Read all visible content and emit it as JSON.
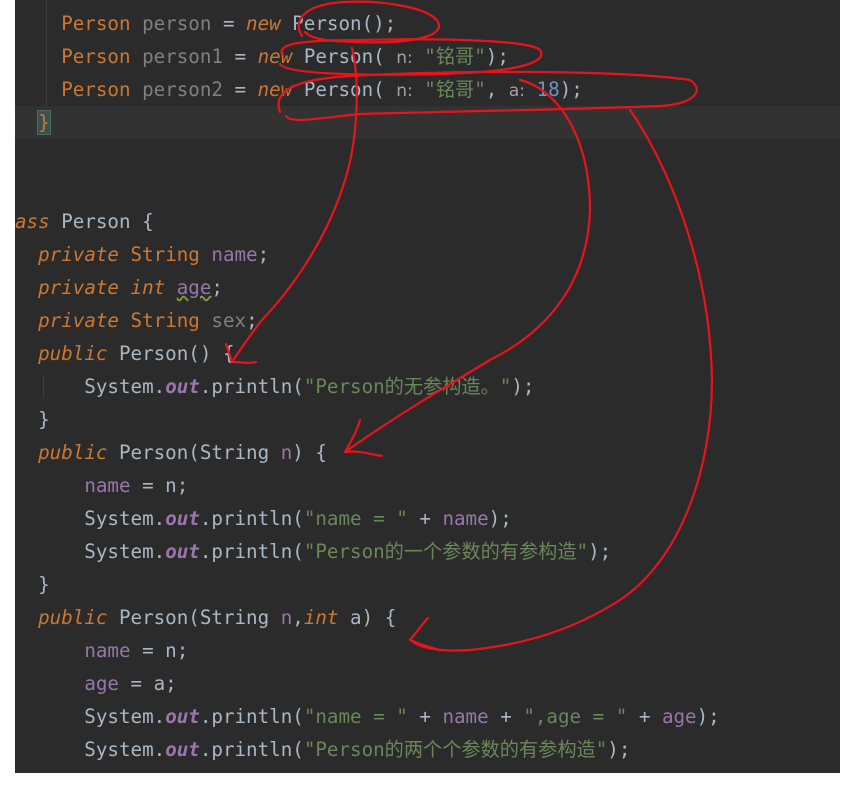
{
  "lines": [
    [
      {
        "t": "    Person ",
        "c": "k"
      },
      {
        "t": "person",
        "c": "gr"
      },
      {
        "t": " = ",
        "c": "t"
      },
      {
        "t": "new",
        "c": "ki"
      },
      {
        "t": " Person();",
        "c": "t"
      }
    ],
    [
      {
        "t": "    Person ",
        "c": "k"
      },
      {
        "t": "person1",
        "c": "gr"
      },
      {
        "t": " = ",
        "c": "t"
      },
      {
        "t": "new",
        "c": "ki"
      },
      {
        "t": " Person( ",
        "c": "t"
      },
      {
        "t": "n:",
        "c": "ph"
      },
      {
        "t": " \"铭哥\"",
        "c": "s"
      },
      {
        "t": ");",
        "c": "t"
      }
    ],
    [
      {
        "t": "    Person ",
        "c": "k"
      },
      {
        "t": "person2",
        "c": "gr"
      },
      {
        "t": " = ",
        "c": "t"
      },
      {
        "t": "new",
        "c": "ki"
      },
      {
        "t": " Person( ",
        "c": "t"
      },
      {
        "t": "n:",
        "c": "ph"
      },
      {
        "t": " \"铭哥\"",
        "c": "s"
      },
      {
        "t": ", ",
        "c": "t"
      },
      {
        "t": "a:",
        "c": "ph"
      },
      {
        "t": " 18",
        "c": "num"
      },
      {
        "t": ");",
        "c": "t"
      }
    ],
    [
      {
        "t": "  ",
        "c": "t"
      },
      {
        "t": "}",
        "c": "brace"
      }
    ],
    [],
    [],
    [
      {
        "t": "ass ",
        "c": "ki"
      },
      {
        "t": "Person {",
        "c": "t"
      }
    ],
    [
      {
        "t": "  ",
        "c": "t"
      },
      {
        "t": "private",
        "c": "ki"
      },
      {
        "t": " String ",
        "c": "k"
      },
      {
        "t": "name",
        "c": "f"
      },
      {
        "t": ";",
        "c": "t"
      }
    ],
    [
      {
        "t": "  ",
        "c": "t"
      },
      {
        "t": "private",
        "c": "ki"
      },
      {
        "t": " int ",
        "c": "ki"
      },
      {
        "t": "age",
        "c": "fw"
      },
      {
        "t": ";",
        "c": "t"
      }
    ],
    [
      {
        "t": "  ",
        "c": "t"
      },
      {
        "t": "private",
        "c": "ki"
      },
      {
        "t": " String ",
        "c": "k"
      },
      {
        "t": "sex",
        "c": "gr"
      },
      {
        "t": ";",
        "c": "t"
      }
    ],
    [
      {
        "t": "  ",
        "c": "t"
      },
      {
        "t": "public",
        "c": "ki"
      },
      {
        "t": " Person() {",
        "c": "t"
      }
    ],
    [
      {
        "t": "      System.",
        "c": "t"
      },
      {
        "t": "out",
        "c": "fb"
      },
      {
        "t": ".println(",
        "c": "t"
      },
      {
        "t": "\"Person的无参构造。\"",
        "c": "s"
      },
      {
        "t": ");",
        "c": "t"
      }
    ],
    [
      {
        "t": "  }",
        "c": "t"
      }
    ],
    [
      {
        "t": "  ",
        "c": "t"
      },
      {
        "t": "public",
        "c": "ki"
      },
      {
        "t": " Person(String ",
        "c": "t"
      },
      {
        "t": "n",
        "c": "f"
      },
      {
        "t": ") {",
        "c": "t"
      }
    ],
    [
      {
        "t": "      ",
        "c": "t"
      },
      {
        "t": "name",
        "c": "f"
      },
      {
        "t": " = n;",
        "c": "t"
      }
    ],
    [
      {
        "t": "      System.",
        "c": "t"
      },
      {
        "t": "out",
        "c": "fb"
      },
      {
        "t": ".println(",
        "c": "t"
      },
      {
        "t": "\"name = \"",
        "c": "s"
      },
      {
        "t": " + ",
        "c": "t"
      },
      {
        "t": "name",
        "c": "f"
      },
      {
        "t": ");",
        "c": "t"
      }
    ],
    [
      {
        "t": "      System.",
        "c": "t"
      },
      {
        "t": "out",
        "c": "fb"
      },
      {
        "t": ".println(",
        "c": "t"
      },
      {
        "t": "\"Person的一个参数的有参构造\"",
        "c": "s"
      },
      {
        "t": ");",
        "c": "t"
      }
    ],
    [
      {
        "t": "  }",
        "c": "t"
      }
    ],
    [
      {
        "t": "  ",
        "c": "t"
      },
      {
        "t": "public",
        "c": "ki"
      },
      {
        "t": " Person(String ",
        "c": "t"
      },
      {
        "t": "n",
        "c": "f"
      },
      {
        "t": ",",
        "c": "t"
      },
      {
        "t": "int",
        "c": "ki"
      },
      {
        "t": " a) {",
        "c": "t"
      }
    ],
    [
      {
        "t": "      ",
        "c": "t"
      },
      {
        "t": "name",
        "c": "f"
      },
      {
        "t": " = n;",
        "c": "t"
      }
    ],
    [
      {
        "t": "      ",
        "c": "t"
      },
      {
        "t": "age",
        "c": "f"
      },
      {
        "t": " = a;",
        "c": "t"
      }
    ],
    [
      {
        "t": "      System.",
        "c": "t"
      },
      {
        "t": "out",
        "c": "fb"
      },
      {
        "t": ".println(",
        "c": "t"
      },
      {
        "t": "\"name = \"",
        "c": "s"
      },
      {
        "t": " + ",
        "c": "t"
      },
      {
        "t": "name",
        "c": "f"
      },
      {
        "t": " + ",
        "c": "t"
      },
      {
        "t": "\",age = \"",
        "c": "s"
      },
      {
        "t": " + ",
        "c": "t"
      },
      {
        "t": "age",
        "c": "f"
      },
      {
        "t": ");",
        "c": "t"
      }
    ],
    [
      {
        "t": "      System.",
        "c": "t"
      },
      {
        "t": "out",
        "c": "fb"
      },
      {
        "t": ".println(",
        "c": "t"
      },
      {
        "t": "\"Person的两个个参数的有参构造\"",
        "c": "s"
      },
      {
        "t": ");",
        "c": "t"
      }
    ]
  ],
  "colors": {
    "editor_bg": "#2b2b2b",
    "keyword": "#cc7832",
    "string": "#6a8759",
    "field": "#9876aa",
    "number": "#6897bb",
    "plain": "#a9b7c6",
    "unused": "#808080",
    "annotation": "#e8141c"
  },
  "annotations": {
    "type": "hand-drawn red arrows linking constructor calls to constructor definitions"
  }
}
